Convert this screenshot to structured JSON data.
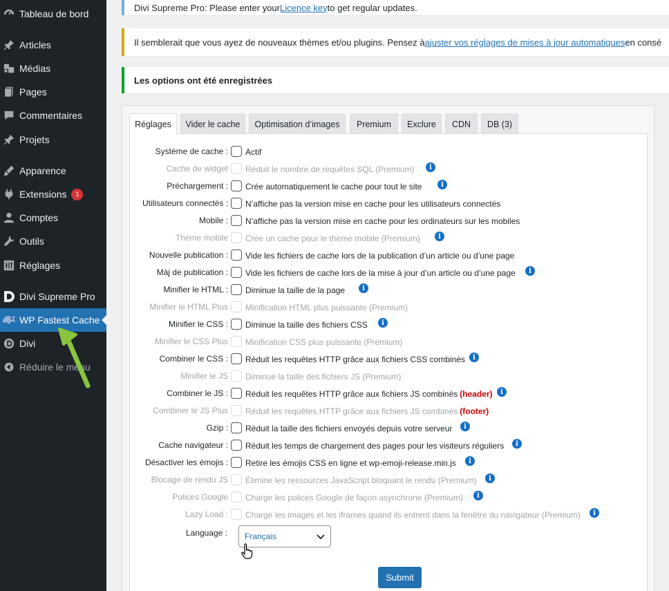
{
  "sidebar": {
    "items": [
      {
        "label": "Tableau de bord",
        "icon": "dashboard-icon"
      },
      {
        "label": "Articles",
        "icon": "pin-icon"
      },
      {
        "label": "Médias",
        "icon": "media-icon"
      },
      {
        "label": "Pages",
        "icon": "pages-icon"
      },
      {
        "label": "Commentaires",
        "icon": "comment-icon"
      },
      {
        "label": "Projets",
        "icon": "pin-icon"
      },
      {
        "label": "Apparence",
        "icon": "brush-icon"
      },
      {
        "label": "Extensions",
        "icon": "plugin-icon",
        "badge": "1"
      },
      {
        "label": "Comptes",
        "icon": "user-icon"
      },
      {
        "label": "Outils",
        "icon": "wrench-icon"
      },
      {
        "label": "Réglages",
        "icon": "settings-icon"
      },
      {
        "label": "Divi Supreme Pro",
        "icon": "divi-supreme-icon"
      },
      {
        "label": "WP Fastest Cache",
        "icon": "cheetah-icon",
        "active": true
      },
      {
        "label": "Divi",
        "icon": "divi-icon"
      },
      {
        "label": "Réduire le menu",
        "icon": "collapse-icon"
      }
    ]
  },
  "notices": {
    "licence": {
      "before": "Divi Supreme Pro: Please enter your ",
      "link": "Licence key",
      "after": " to get regular updates."
    },
    "updates": {
      "before": "Il semblerait que vous ayez de nouveaux thèmes et/ou plugins. Pensez à ",
      "link": "ajuster vos réglages de mises à jour automatiques",
      "after": " en consé"
    },
    "saved": "Les options ont été enregistrées"
  },
  "tabs": [
    "Réglages",
    "Vider le cache",
    "Optimisation d’images",
    "Premium",
    "Exclure",
    "CDN",
    "DB (3)"
  ],
  "settings": [
    {
      "label": "Système de cache :",
      "desc": "Actif",
      "disabled": false,
      "info": false
    },
    {
      "label": "Cache de widget",
      "desc": "Réduit le nombre de requêtes SQL (Premium)",
      "disabled": true,
      "info": true
    },
    {
      "label": "Préchargement :",
      "desc": "Crée automatiquement le cache pour tout le site",
      "disabled": false,
      "info": true
    },
    {
      "label": "Utilisateurs connectés :",
      "desc": "N’affiche pas la version mise en cache pour les utilisateurs connectés",
      "disabled": false,
      "info": false
    },
    {
      "label": "Mobile :",
      "desc": "N’affiche pas la version mise en cache pour les ordinateurs sur les mobiles",
      "disabled": false,
      "info": false
    },
    {
      "label": "Thème mobile",
      "desc": "Crée un cache pour le thème mobile (Premium)",
      "disabled": true,
      "info": true
    },
    {
      "label": "Nouvelle publication :",
      "desc": "Vide les fichiers de cache lors de la publication d’un article ou d’une page",
      "disabled": false,
      "info": false
    },
    {
      "label": "Màj de publication :",
      "desc": "Vide les fichiers de cache lors de la mise à jour d’un article ou d’une page",
      "disabled": false,
      "info": true
    },
    {
      "label": "Minifier le HTML :",
      "desc": "Diminue la taille de la page",
      "disabled": false,
      "info": true
    },
    {
      "label": "Minifier le HTML Plus",
      "desc": "Minification HTML plus puissante (Premium)",
      "disabled": true,
      "info": false
    },
    {
      "label": "Minifier le CSS :",
      "desc": "Diminue la taille des fichiers CSS",
      "disabled": false,
      "info": true
    },
    {
      "label": "Minifier le CSS Plus",
      "desc": "Minification CSS plus puissante (Premium)",
      "disabled": true,
      "info": false
    },
    {
      "label": "Combiner le CSS :",
      "desc": "Réduit les requêtes HTTP grâce aux fichiers CSS combinés",
      "disabled": false,
      "info": true
    },
    {
      "label": "Minifier le JS",
      "desc": "Diminue la taille des fichiers JS (Premium)",
      "disabled": true,
      "info": false
    },
    {
      "label": "Combiner le JS :",
      "desc": "Réduit les requêtes HTTP grâce aux fichiers JS combinés",
      "extra": "(header)",
      "disabled": false,
      "info": true
    },
    {
      "label": "Combiner le JS Plus",
      "desc": "Réduit les requêtes HTTP grâce aux fichiers JS combinés",
      "extra": "(footer)",
      "disabled": true,
      "info": false
    },
    {
      "label": "Gzip :",
      "desc": "Réduit la taille des fichiers envoyés depuis votre serveur",
      "disabled": false,
      "info": true
    },
    {
      "label": "Cache navigateur :",
      "desc": "Réduit les temps de chargement des pages pour les visiteurs réguliers",
      "disabled": false,
      "info": true
    },
    {
      "label": "Désactiver les émojis :",
      "desc": "Retire les émojis CSS en ligne et wp-emoji-release.min.js",
      "disabled": false,
      "info": true
    },
    {
      "label": "Blocage de rendu JS",
      "desc": "Élimine les ressources JavaScript bloquant le rendu (Premium)",
      "disabled": true,
      "info": true
    },
    {
      "label": "Polices Google",
      "desc": "Charge les polices Google de façon asynchrone (Premium)",
      "disabled": true,
      "info": true
    },
    {
      "label": "Lazy Load :",
      "desc": "Charge les images et les iframes quand ils entrent dans la fenêtre du navigateur (Premium)",
      "disabled": true,
      "info": true
    }
  ],
  "language": {
    "label": "Language :",
    "value": "Français"
  },
  "submit_label": "Submit",
  "colors": {
    "sidebar_bg": "#1d2327",
    "accent": "#2271b1",
    "arrow": "#8ac43f",
    "info": "#1570c5",
    "warning_text": "#cc0000"
  }
}
